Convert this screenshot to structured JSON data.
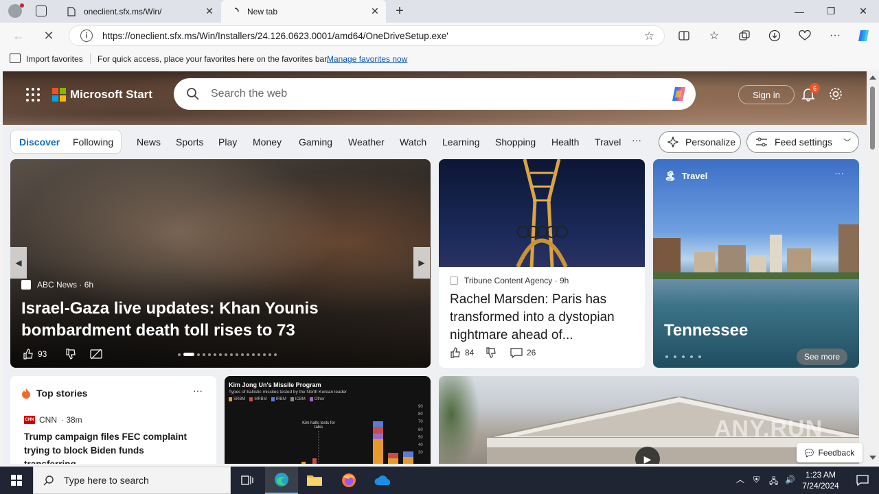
{
  "browser": {
    "tabs": [
      {
        "title": "oneclient.sfx.ms/Win/"
      },
      {
        "title": "New tab"
      }
    ],
    "url": "https://oneclient.sfx.ms/Win/Installers/24.126.0623.0001/amd64/OneDriveSetup.exe'",
    "favorites_bar": {
      "import_label": "Import favorites",
      "hint": "For quick access, place your favorites here on the favorites bar.",
      "manage_link": "Manage favorites now"
    }
  },
  "msn": {
    "brand": "Microsoft Start",
    "search_placeholder": "Search the web",
    "sign_in": "Sign in",
    "notification_count": "6",
    "feed_tabs": {
      "discover": "Discover",
      "following": "Following"
    },
    "categories": [
      "News",
      "Sports",
      "Play",
      "Money",
      "Gaming",
      "Weather",
      "Watch",
      "Learning",
      "Shopping",
      "Health",
      "Travel"
    ],
    "more": "···",
    "personalize": "Personalize",
    "feed_settings": "Feed settings"
  },
  "cards": {
    "hero": {
      "source": "ABC News",
      "age": "· 6h",
      "title": "Israel-Gaza live updates: Khan Younis bombardment death toll rises to 73",
      "likes": "93"
    },
    "paris": {
      "source": "Tribune Content Agency",
      "age": "· 9h",
      "title": "Rachel Marsden: Paris has transformed into a dystopian nightmare ahead of...",
      "likes": "84",
      "comments": "26"
    },
    "travel": {
      "section": "Travel",
      "more": "···",
      "place": "Tennessee",
      "see_more": "See more"
    },
    "top_stories": {
      "heading": "Top stories",
      "more": "···",
      "source": "CNN",
      "age": "· 38m",
      "title": "Trump campaign files FEC complaint trying to block Biden funds transferring..."
    },
    "infographic": {
      "title": "Kim Jong Un's Missile Program",
      "subtitle": "Types of ballistic missiles tested by the North Korean leader",
      "legend": [
        "SRBM",
        "MRBM",
        "IRBM",
        "ICBM",
        "Other"
      ],
      "annotation": "Kim halts tests for talks",
      "yticks": [
        "90",
        "80",
        "70",
        "60",
        "50",
        "40",
        "30"
      ]
    }
  },
  "page": {
    "feedback": "Feedback",
    "watermark": "ANY.RUN"
  },
  "taskbar": {
    "search_placeholder": "Type here to search",
    "time": "1:23 AM",
    "date": "7/24/2024"
  },
  "colors": {
    "accent": "#0f6cbd",
    "notification": "#e8562a",
    "cnn": "#cc0000"
  }
}
